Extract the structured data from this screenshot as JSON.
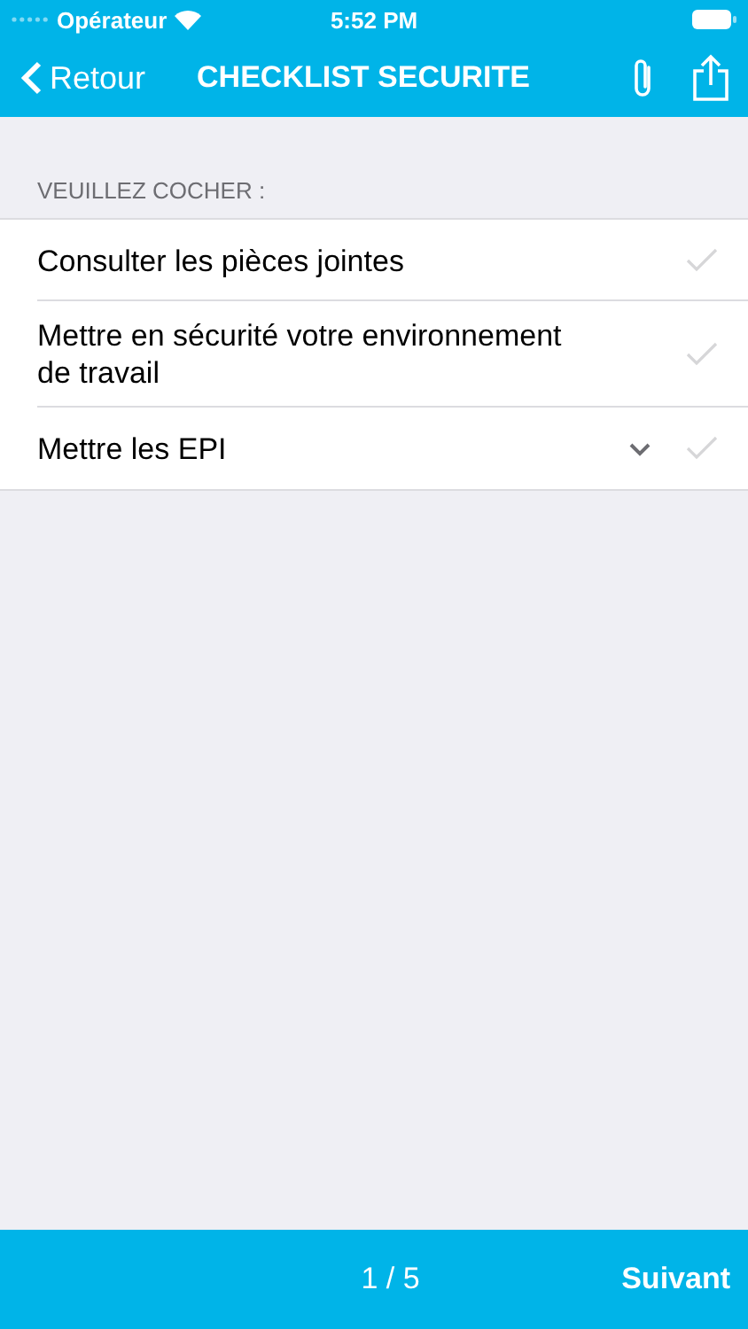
{
  "status_bar": {
    "carrier": "Opérateur",
    "time": "5:52 PM"
  },
  "nav": {
    "back": "Retour",
    "title": "CHECKLIST SECURITE"
  },
  "section_header": "VEUILLEZ COCHER :",
  "items": [
    {
      "label": "Consulter les pièces jointes",
      "kind": "plain",
      "checked": false
    },
    {
      "label": "Mettre en sécurité votre environnement de travail",
      "kind": "plain",
      "checked": false
    },
    {
      "label": "Mettre les EPI",
      "kind": "expandable",
      "checked": false
    }
  ],
  "footer": {
    "page": "1 / 5",
    "next": "Suivant"
  }
}
